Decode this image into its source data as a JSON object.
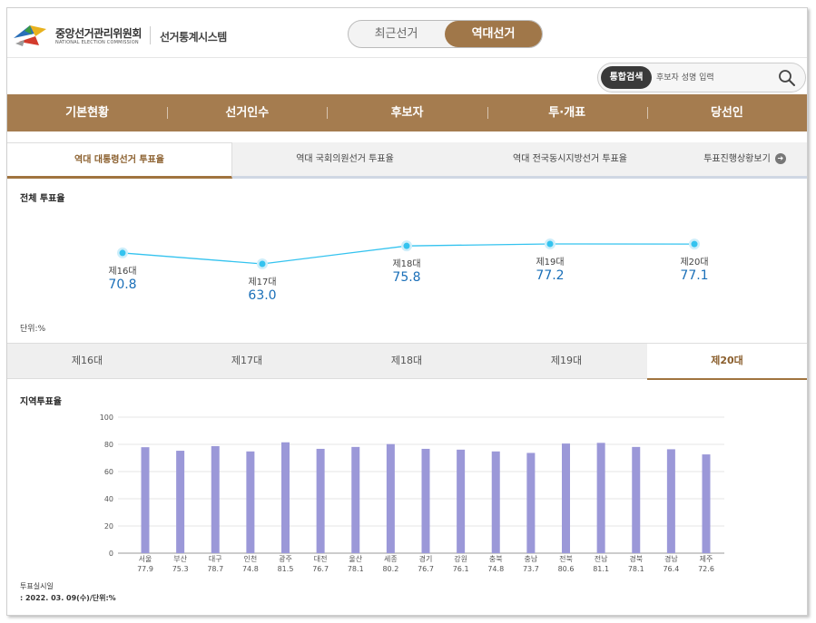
{
  "header": {
    "org_name": "중앙선거관리위원회",
    "org_sub": "NATIONAL ELECTION COMMISSION",
    "system_name": "선거통계시스템",
    "toggle": {
      "left": "최근선거",
      "right": "역대선거",
      "selected": "역대선거"
    }
  },
  "search": {
    "badge": "통합검색",
    "placeholder": "후보자 성명 입력",
    "icon": "search-icon"
  },
  "nav": [
    "기본현황",
    "선거인수",
    "후보자",
    "투·개표",
    "당선인"
  ],
  "subtabs": [
    {
      "label": "역대 대통령선거 투표율",
      "active": true
    },
    {
      "label": "역대 국회의원선거 투표율",
      "active": false
    },
    {
      "label": "역대 전국동시지방선거 투표율",
      "active": false
    },
    {
      "label": "투표진행상황보기",
      "active": false,
      "icon": "arrow-right-icon"
    }
  ],
  "overall": {
    "title": "전체 투표율",
    "unit": "단위:%",
    "points": [
      {
        "label": "제16대",
        "value": "70.8"
      },
      {
        "label": "제17대",
        "value": "63.0"
      },
      {
        "label": "제18대",
        "value": "75.8"
      },
      {
        "label": "제19대",
        "value": "77.2"
      },
      {
        "label": "제20대",
        "value": "77.1"
      }
    ]
  },
  "election_tabs": [
    {
      "label": "제16대",
      "active": false
    },
    {
      "label": "제17대",
      "active": false
    },
    {
      "label": "제18대",
      "active": false
    },
    {
      "label": "제19대",
      "active": false
    },
    {
      "label": "제20대",
      "active": true
    }
  ],
  "regional": {
    "title": "지역투표율"
  },
  "chart_data": {
    "type": "bar",
    "categories": [
      "서울",
      "부산",
      "대구",
      "인천",
      "광주",
      "대전",
      "울산",
      "세종",
      "경기",
      "강원",
      "충북",
      "충남",
      "전북",
      "전남",
      "경북",
      "경남",
      "제주"
    ],
    "values": [
      77.9,
      75.3,
      78.7,
      74.8,
      81.5,
      76.7,
      78.1,
      80.2,
      76.7,
      76.1,
      74.8,
      73.7,
      80.6,
      81.1,
      78.1,
      76.4,
      72.6
    ],
    "value_labels": [
      "77.9",
      "75.3",
      "78.7",
      "74.8",
      "81.5",
      "76.7",
      "78.1",
      "80.2",
      "76.7",
      "76.1",
      "74.8",
      "73.7",
      "80.6",
      "81.1",
      "78.1",
      "76.4",
      "72.6"
    ],
    "ylim": [
      0,
      100
    ],
    "yticks": [
      "0",
      "20",
      "40",
      "60",
      "80",
      "100"
    ],
    "grid": true,
    "color": "#9b98d8"
  },
  "footer": {
    "line1": "투표실시일",
    "line2": ": 2022. 03. 09(수)/단위:%"
  },
  "colors": {
    "brand": "#a57c4f",
    "accent_text": "#8a5e2c",
    "line": "#34c3ef",
    "value_text": "#1a6fb8"
  }
}
